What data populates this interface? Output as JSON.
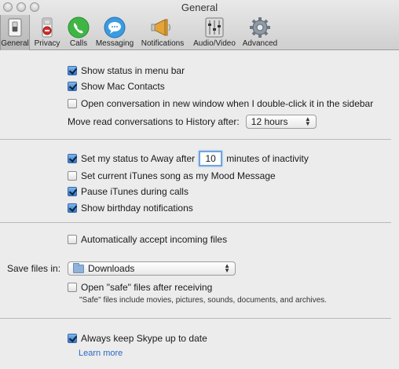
{
  "window": {
    "title": "General"
  },
  "tabs": [
    {
      "label": "General",
      "icon": "general-switch-icon",
      "selected": true
    },
    {
      "label": "Privacy",
      "icon": "privacy-stop-icon",
      "selected": false
    },
    {
      "label": "Calls",
      "icon": "phone-icon",
      "selected": false
    },
    {
      "label": "Messaging",
      "icon": "speech-bubble-icon",
      "selected": false
    },
    {
      "label": "Notifications",
      "icon": "megaphone-icon",
      "selected": false
    },
    {
      "label": "Audio/Video",
      "icon": "mixer-icon",
      "selected": false
    },
    {
      "label": "Advanced",
      "icon": "gear-icon",
      "selected": false
    }
  ],
  "general": {
    "show_status": {
      "label": "Show status in menu bar",
      "checked": true
    },
    "show_mac_contacts": {
      "label": "Show Mac Contacts",
      "checked": true
    },
    "open_new_window": {
      "label": "Open conversation in new window when I double-click it in the sidebar",
      "checked": false
    },
    "move_history_label": "Move read conversations to History after:",
    "move_history_value": "12 hours"
  },
  "status": {
    "away_prefix": "Set my status to Away after",
    "away_minutes": "10",
    "away_suffix": "minutes of inactivity",
    "away_checked": true,
    "itunes_song": {
      "label": "Set current iTunes song as my Mood Message",
      "checked": false
    },
    "pause_itunes": {
      "label": "Pause iTunes during calls",
      "checked": true
    },
    "birthday": {
      "label": "Show birthday notifications",
      "checked": true
    }
  },
  "files": {
    "auto_accept": {
      "label": "Automatically accept incoming files",
      "checked": false
    },
    "save_label": "Save files in:",
    "save_location": "Downloads",
    "open_safe": {
      "label": "Open \"safe\" files after receiving",
      "checked": false
    },
    "safe_note": "\"Safe\" files include movies, pictures, sounds, documents, and archives."
  },
  "updates": {
    "auto_update": {
      "label": "Always keep Skype up to date",
      "checked": true
    },
    "learn_more": "Learn more"
  },
  "colors": {
    "accent": "#2f76c9",
    "link": "#2a6ac8"
  }
}
